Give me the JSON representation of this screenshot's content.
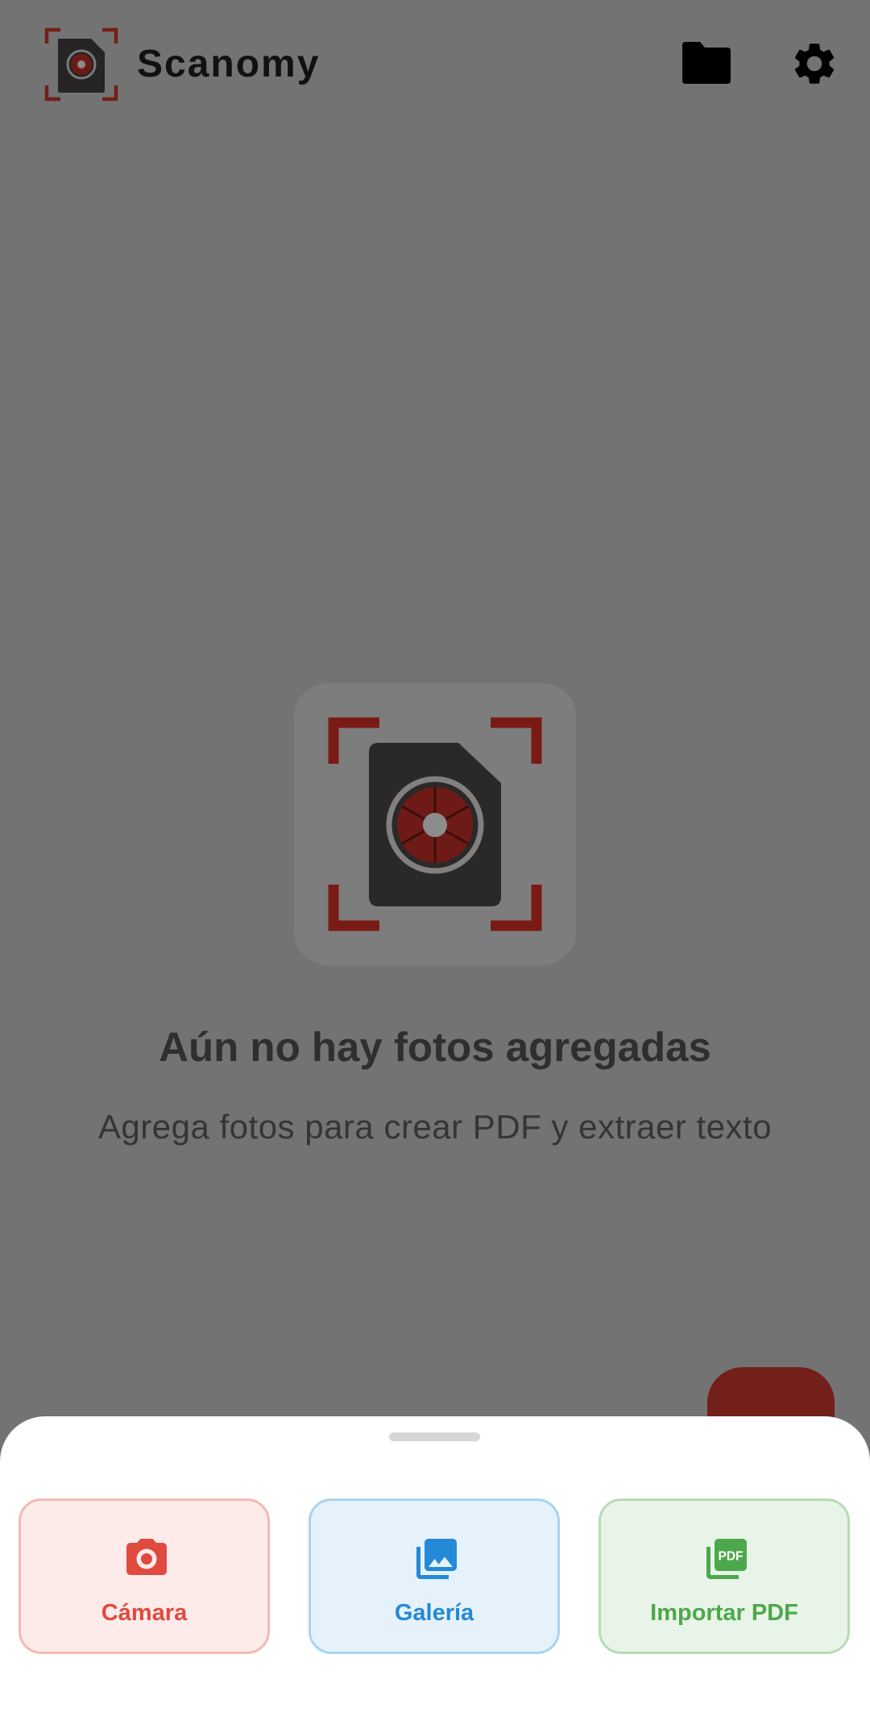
{
  "appbar": {
    "title": "Scanomy",
    "logo_icon": "scanner-logo-icon",
    "actions": [
      "folder-icon",
      "settings-gear-icon"
    ]
  },
  "empty_state": {
    "illustration_icon": "document-scanner-icon",
    "title": "Aún no hay fotos agregadas",
    "subtitle": "Agrega fotos para crear PDF y extraer texto"
  },
  "fab": {
    "icon": "add-icon",
    "color": "#731f1a"
  },
  "sheet": {
    "actions": [
      {
        "label": "Cámara",
        "icon": "camera-icon",
        "color": "#e04a3f"
      },
      {
        "label": "Galería",
        "icon": "photo-library-icon",
        "color": "#2489d6"
      },
      {
        "label": "Importar PDF",
        "icon": "pdf-icon",
        "color": "#4da84b"
      }
    ]
  },
  "colors": {
    "scrim": "#737373",
    "brand_red": "#8b1a14",
    "sheet_bg": "#ffffff"
  }
}
